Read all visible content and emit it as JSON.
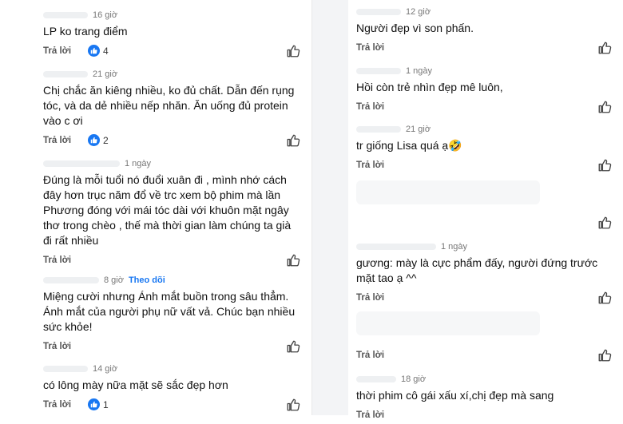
{
  "reply_label": "Trả lời",
  "follow_label": "Theo dõi",
  "left_comments": [
    {
      "time": "16 giờ",
      "text": "LP ko trang điểm",
      "likes": "4"
    },
    {
      "time": "21 giờ",
      "text": "Chị chắc ăn kiêng nhiều, ko đủ chất. Dẫn đến rụng tóc, và da dẻ nhiều nếp nhăn. Ăn uống đủ protein vào c ơi",
      "likes": "2"
    },
    {
      "time": "1 ngày",
      "text": "Đúng là mỗi tuổi nó đuổi xuân đi , mình nhớ cách đây hơn trục năm đổ về trc xem bộ phim mà lần Phương đóng với mái tóc dài với khuôn mặt ngây thơ trong chèo , thế mà thời gian làm chúng ta già đi rất nhiều",
      "likes": ""
    },
    {
      "time": "8 giờ",
      "text": "Miệng cười nhưng Ánh mắt buồn trong sâu thẳm. Ánh mắt của người phụ nữ vất vả. Chúc bạn nhiều sức khỏe!",
      "likes": ""
    },
    {
      "time": "14 giờ",
      "text": "có lông mày nữa mặt sẽ sắc đẹp hơn",
      "likes": "1"
    }
  ],
  "right_comments": [
    {
      "time": "12 giờ",
      "text": "Người đẹp vì son phấn."
    },
    {
      "time": "1 ngày",
      "text": "Hồi còn trẻ nhìn đẹp mê luôn,"
    },
    {
      "time": "21 giờ",
      "text": "tr giống Lisa quá ạ🤣"
    },
    {
      "time": "",
      "text": ""
    },
    {
      "time": "1 ngày",
      "text": "gương: mày là cực phẩm đấy, người đứng trước mặt tao ạ ^^"
    },
    {
      "time": "",
      "text": ""
    },
    {
      "time": "18 giờ",
      "text": "thời phim cô gái xấu xí,chị đẹp mà sang"
    }
  ],
  "colors": {
    "like_blue": "#1877f2",
    "follow_blue": "#1877f2"
  },
  "icons": {
    "like_badge": "thumbs-up-badge-icon",
    "like_button": "thumbs-up-outline-icon"
  }
}
